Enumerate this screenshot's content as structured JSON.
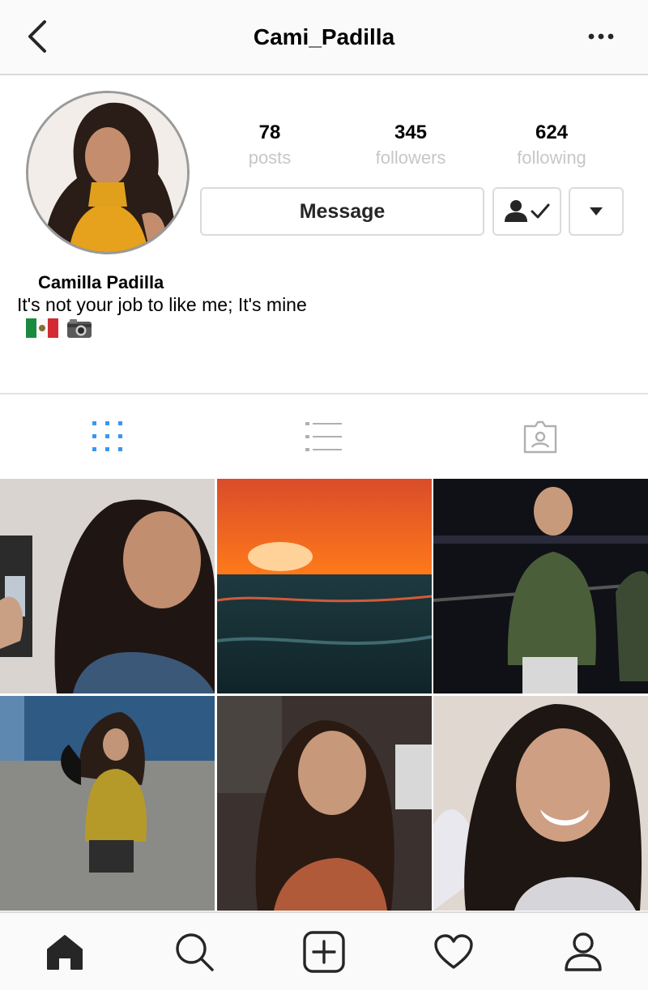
{
  "header": {
    "title": "Cami_Padilla"
  },
  "profile": {
    "full_name": "Camilla Padilla",
    "bio": "It's not your job to like me; It's mine",
    "emojis": [
      "mexico-flag",
      "camera"
    ]
  },
  "stats": [
    {
      "value": "78",
      "label": "posts"
    },
    {
      "value": "345",
      "label": "followers"
    },
    {
      "value": "624",
      "label": "following"
    }
  ],
  "actions": {
    "message_label": "Message"
  },
  "tabs": [
    {
      "icon": "grid-icon",
      "active": true
    },
    {
      "icon": "list-icon",
      "active": false
    },
    {
      "icon": "tagged-icon",
      "active": false
    }
  ],
  "posts": [
    {
      "description": "selfie"
    },
    {
      "description": "sunset over ocean"
    },
    {
      "description": "friend at night"
    },
    {
      "description": "plaid dress outdoors"
    },
    {
      "description": "smiling portrait"
    },
    {
      "description": "smiling selfie"
    }
  ],
  "colors": {
    "accent": "#3897f0",
    "muted": "#c7c7c7",
    "border": "#dbdbdb"
  }
}
